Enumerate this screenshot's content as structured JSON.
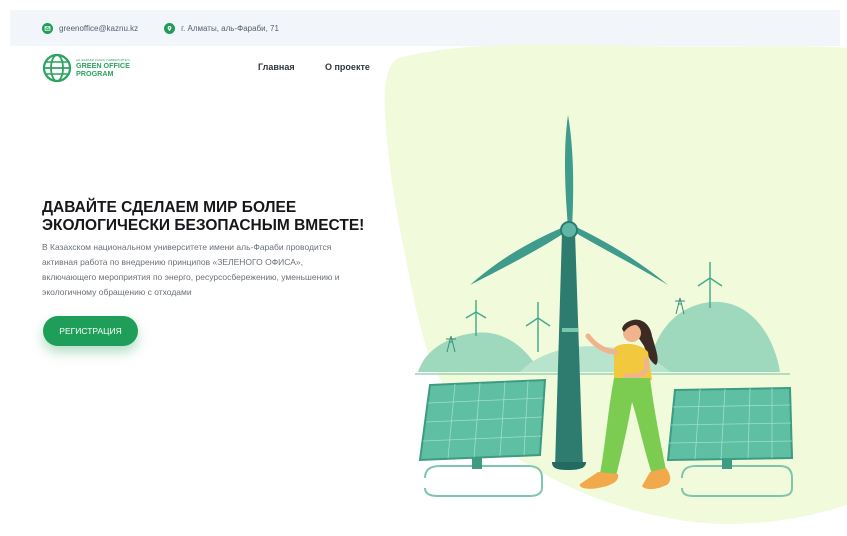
{
  "topbar": {
    "email": "greenoffice@kaznu.kz",
    "address": "г. Алматы, аль-Фараби, 71"
  },
  "logo": {
    "small_text": "АЛ-ФАРАБИ КАЗАҚ УНИВЕРСИТЕТІ",
    "line1": "GREEN OFFICE",
    "line2": "PROGRAM"
  },
  "nav": {
    "items": [
      "Главная",
      "О проекте"
    ]
  },
  "hero": {
    "title_line1": "ДАВАЙТЕ СДЕЛАЕМ МИР БОЛЕЕ",
    "title_line2": "ЭКОЛОГИЧЕСКИ БЕЗОПАСНЫМ ВМЕСТЕ!",
    "desc_line1": "В Казахском национальном университете имени аль-Фараби проводится",
    "desc_line2": "активная работа по внедрению принципов «ЗЕЛЕНОГО ОФИСА»,",
    "desc_line3": "включающего мероприятия по энерго, ресурсосбережению, уменьшению и",
    "desc_line4": "экологичному обращению с отходами",
    "register_label": "РЕГИСТРАЦИЯ"
  },
  "colors": {
    "brand": "#1f9e5a",
    "blob": "#f1fbdc",
    "turbine": "#2e7b70",
    "panel": "#5fbfa2"
  }
}
